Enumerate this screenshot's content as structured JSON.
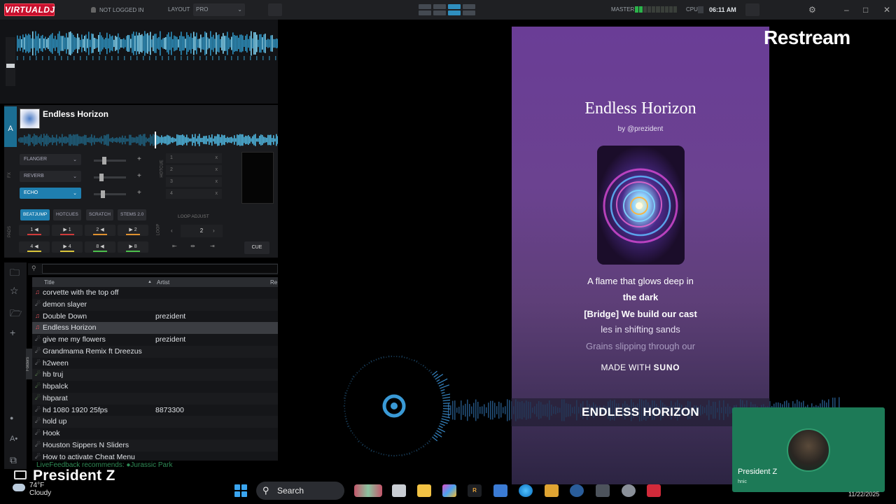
{
  "topbar": {
    "logo": "VIRTUALDJ",
    "login": "NOT LOGGED IN",
    "layout_label": "LAYOUT",
    "layout_value": "PRO",
    "master_label": "MASTER",
    "cpu_label": "CPU",
    "clock": "06:11 AM"
  },
  "deck": {
    "letter": "A",
    "title": "Endless Horizon",
    "fx": [
      "FLANGER",
      "REVERB",
      "ECHO"
    ],
    "hotcue_label": "HOTCUE",
    "hotcues": [
      "1",
      "2",
      "3",
      "4"
    ],
    "fx_label": "FX",
    "pads_label": "PADS",
    "pad_tabs": [
      "BEATJUMP",
      "HOTCUES",
      "SCRATCH",
      "STEMS 2.0"
    ],
    "pads_row1": [
      "1 ◀",
      "▶ 1",
      "2 ◀",
      "▶ 2"
    ],
    "pads_row2": [
      "4 ◀",
      "▶ 4",
      "8 ◀",
      "▶ 8"
    ],
    "loop_label": "LOOP",
    "loop_adjust": "LOOP ADJUST",
    "loop_value": "2",
    "cue": "CUE"
  },
  "browser": {
    "folders_tab": "Folders",
    "columns": {
      "title": "Title",
      "artist": "Artist",
      "extra": "Re"
    },
    "rows": [
      {
        "title": "corvette with the top off",
        "artist": "",
        "icon": "red"
      },
      {
        "title": "demon slayer",
        "artist": "",
        "icon": "white"
      },
      {
        "title": "Double Down",
        "artist": "prezident",
        "icon": "red"
      },
      {
        "title": "Endless Horizon",
        "artist": "",
        "icon": "red",
        "selected": true
      },
      {
        "title": "give me my flowers",
        "artist": "prezident",
        "icon": "white"
      },
      {
        "title": "Grandmama Remix ft Dreezus",
        "artist": "",
        "icon": "white"
      },
      {
        "title": "h2ween",
        "artist": "",
        "icon": "white"
      },
      {
        "title": "hb truj",
        "artist": "",
        "icon": "green"
      },
      {
        "title": "hbpalck",
        "artist": "",
        "icon": "green"
      },
      {
        "title": "hbparat",
        "artist": "",
        "icon": "green"
      },
      {
        "title": "hd 1080 1920 25fps",
        "artist": "8873300",
        "icon": "white"
      },
      {
        "title": "hold up",
        "artist": "",
        "icon": "white"
      },
      {
        "title": "Hook",
        "artist": "",
        "icon": "white"
      },
      {
        "title": "Houston Sippers N Sliders",
        "artist": "",
        "icon": "white"
      },
      {
        "title": "How to activate Cheat Menu",
        "artist": "",
        "icon": "white"
      }
    ],
    "feedback": "LiveFeedback recommends: ●Jurassic Park"
  },
  "stream": {
    "brand": "Restream",
    "song_title": "Endless Horizon",
    "song_by": "by @prezident",
    "lyric_1": "A flame that glows deep in",
    "lyric_2": "the dark",
    "lyric_3": "[Bridge] We build our cast",
    "lyric_4": "les in shifting sands",
    "lyric_5": "Grains slipping through our",
    "made_with": "MADE WITH",
    "made_brand": "SUNO",
    "banner": "ENDLESS HORIZON",
    "cam_name": "President Z",
    "cam_sub": "hnic",
    "streamer_name": "President Z"
  },
  "taskbar": {
    "temp": "74°F",
    "weather": "Cloudy",
    "search": "Search",
    "date": "11/22/2025"
  },
  "colors": {
    "deck_accent": "#1f7fb0",
    "cam_bg": "#1d7a57",
    "suno_purple": "#6a3d96",
    "vdj_red": "#c8102e"
  }
}
